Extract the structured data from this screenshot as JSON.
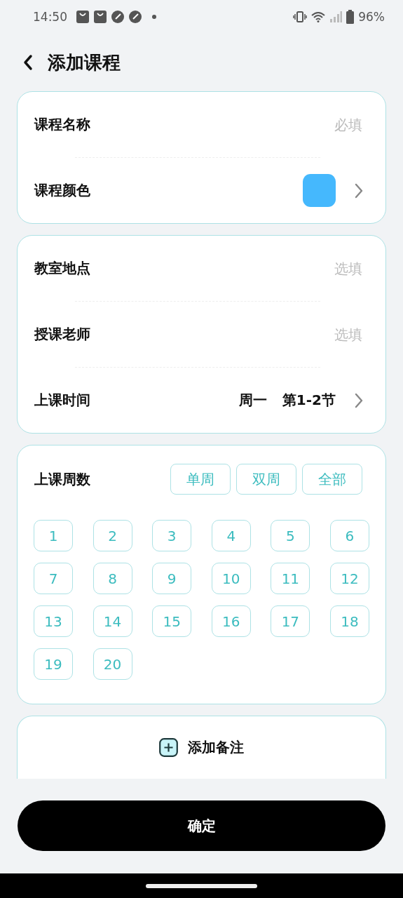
{
  "status_bar": {
    "time": "14:50",
    "battery": "96%"
  },
  "header": {
    "title": "添加课程"
  },
  "sections": [
    {
      "rows": [
        {
          "kind": "input",
          "label": "课程名称",
          "placeholder": "必填"
        },
        {
          "kind": "color",
          "label": "课程颜色",
          "color": "#45b8fd"
        }
      ]
    },
    {
      "rows": [
        {
          "kind": "input",
          "label": "教室地点",
          "placeholder": "选填"
        },
        {
          "kind": "input",
          "label": "授课老师",
          "placeholder": "选填"
        },
        {
          "kind": "picker",
          "label": "上课时间",
          "values": [
            "周一",
            "第1-2节"
          ]
        }
      ]
    }
  ],
  "weeks": {
    "label": "上课周数",
    "filters": [
      {
        "label": "单周",
        "selected": false
      },
      {
        "label": "双周",
        "selected": false
      },
      {
        "label": "全部",
        "selected": false
      }
    ],
    "items": [
      {
        "label": "1",
        "selected": false
      },
      {
        "label": "2",
        "selected": false
      },
      {
        "label": "3",
        "selected": false
      },
      {
        "label": "4",
        "selected": false
      },
      {
        "label": "5",
        "selected": false
      },
      {
        "label": "6",
        "selected": false
      },
      {
        "label": "7",
        "selected": false
      },
      {
        "label": "8",
        "selected": false
      },
      {
        "label": "9",
        "selected": false
      },
      {
        "label": "10",
        "selected": false
      },
      {
        "label": "11",
        "selected": false
      },
      {
        "label": "12",
        "selected": false
      },
      {
        "label": "13",
        "selected": false
      },
      {
        "label": "14",
        "selected": false
      },
      {
        "label": "15",
        "selected": false
      },
      {
        "label": "16",
        "selected": false
      },
      {
        "label": "17",
        "selected": false
      },
      {
        "label": "18",
        "selected": false
      },
      {
        "label": "19",
        "selected": false
      },
      {
        "label": "20",
        "selected": false
      }
    ]
  },
  "note": {
    "label": "添加备注"
  },
  "confirm": {
    "label": "确定"
  }
}
